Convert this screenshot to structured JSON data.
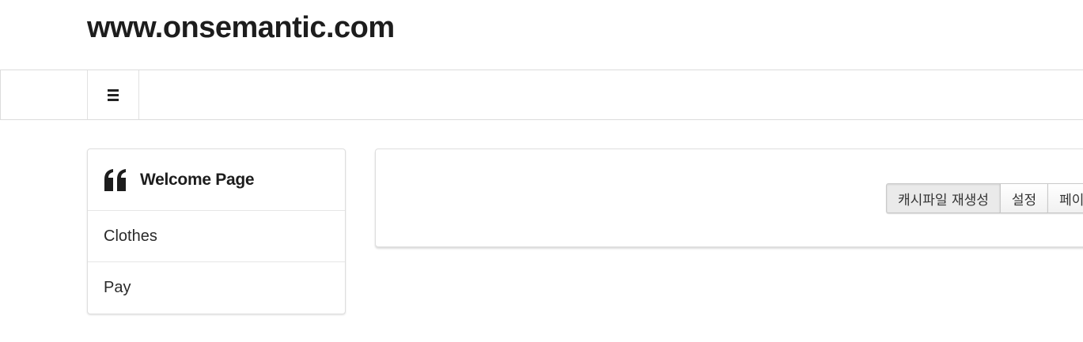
{
  "header": {
    "site_title": "www.onsemantic.com"
  },
  "navbar": {
    "menu_icon": "hamburger-menu-icon"
  },
  "sidebar": {
    "header_icon": "quote-icon",
    "header_label": "Welcome Page",
    "items": [
      {
        "label": "Clothes"
      },
      {
        "label": "Pay"
      }
    ]
  },
  "toolbar": {
    "buttons": [
      {
        "label": "캐시파일 재생성"
      },
      {
        "label": "설정"
      },
      {
        "label": "페이지"
      }
    ]
  }
}
